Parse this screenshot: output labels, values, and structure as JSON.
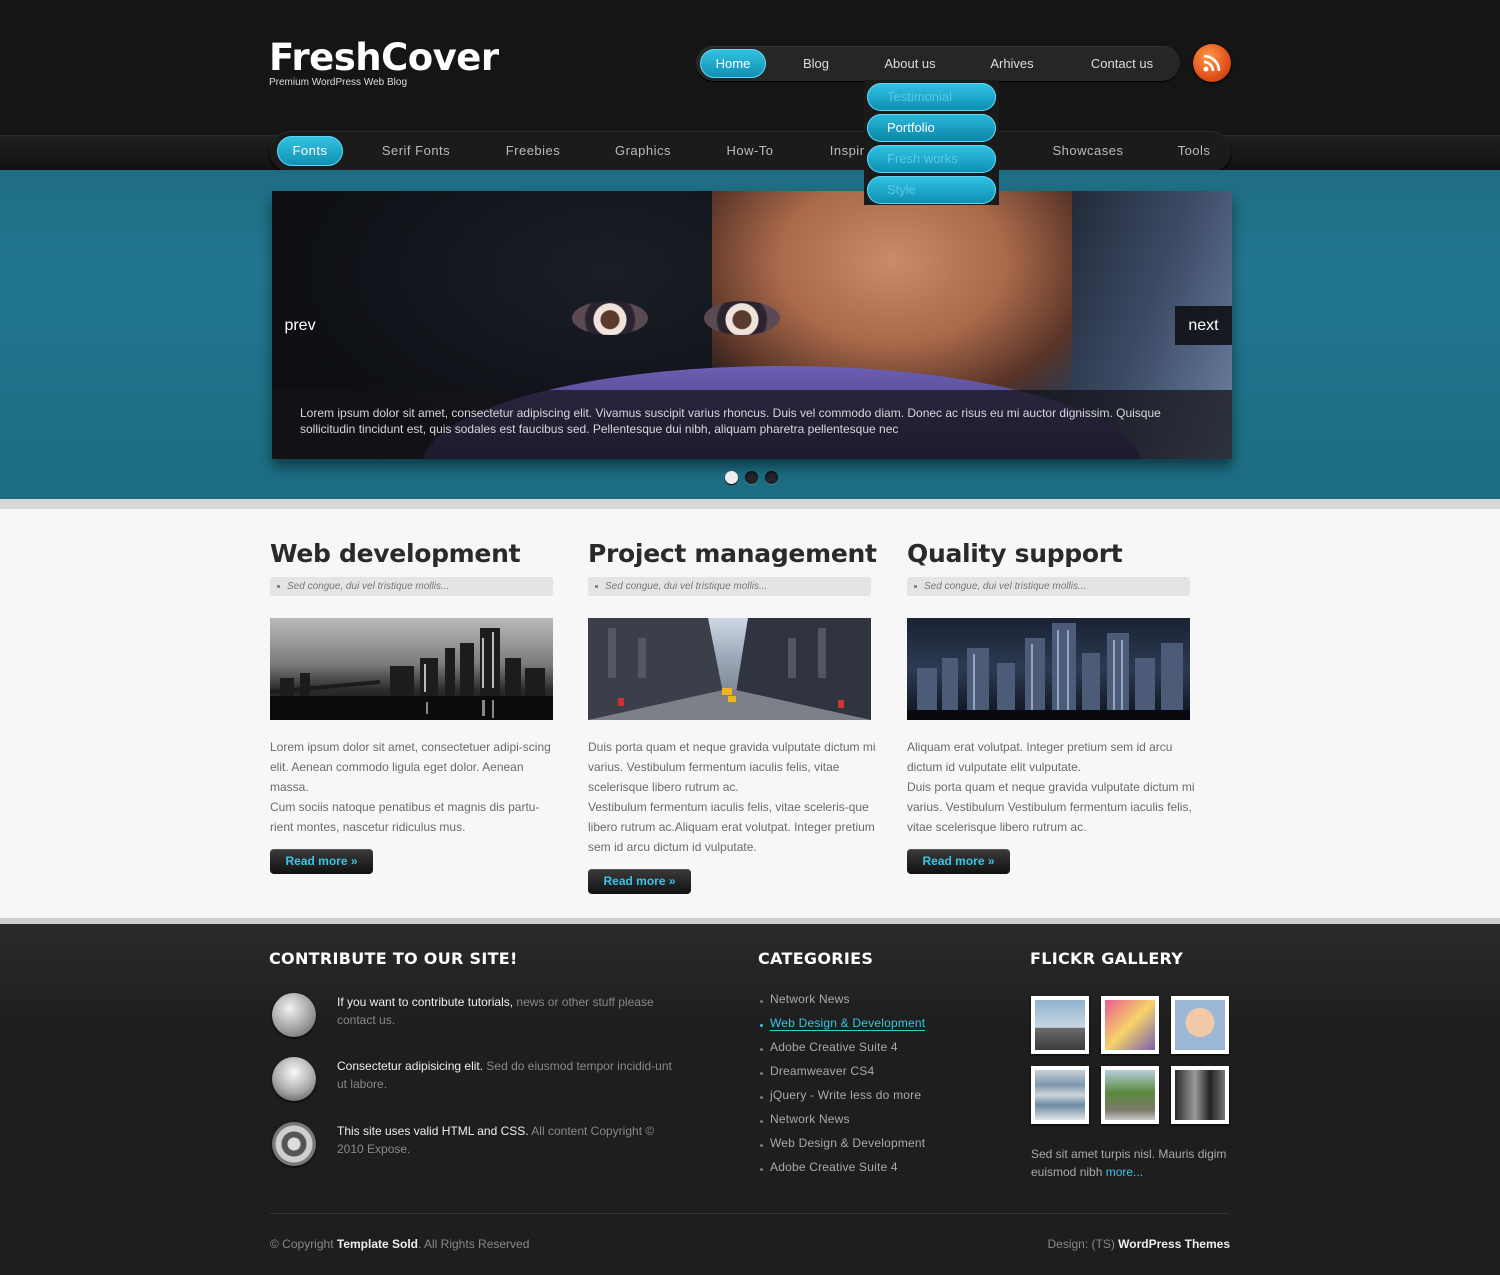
{
  "header": {
    "logo": "FreshCover",
    "tagline": "Premium WordPress Web Blog",
    "nav": [
      "Home",
      "Blog",
      "About us",
      "Arhives",
      "Contact us"
    ],
    "dropdown": [
      "Testimonial",
      "Portfolio",
      "Fresh works",
      "Style"
    ],
    "rss_icon": "rss-icon"
  },
  "subnav": [
    "Fonts",
    "Serif Fonts",
    "Freebies",
    "Graphics",
    "How-To",
    "Inspira",
    "Showcases",
    "Tools"
  ],
  "slider": {
    "prev": "prev",
    "next": "next",
    "caption": "Lorem ipsum dolor sit amet, consectetur adipiscing elit. Vivamus suscipit varius rhoncus. Duis vel commodo diam. Donec ac risus eu mi auctor dignissim. Quisque sollicitudin tincidunt est, quis sodales est faucibus sed. Pellentesque dui nibh, aliquam pharetra pellentesque nec",
    "active_slide": 1,
    "slide_count": 3
  },
  "columns": [
    {
      "title": "Web development",
      "sub": "Sed congue, dui vel tristique mollis...",
      "p1": "Lorem ipsum dolor sit amet, consectetuer adipi-scing elit. Aenean commodo ligula eget dolor. Aenean massa.",
      "p2": "Cum sociis natoque penatibus et magnis dis partu-rient montes, nascetur ridiculus mus.",
      "button": "Read more »"
    },
    {
      "title": "Project management",
      "sub": "Sed congue, dui vel tristique mollis...",
      "p1": "Duis porta quam et neque gravida vulputate dictum mi varius. Vestibulum fermentum iaculis felis, vitae scelerisque libero rutrum ac.",
      "p2": "Vestibulum fermentum iaculis felis, vitae sceleris-que libero rutrum ac.Aliquam erat volutpat. Integer pretium sem id arcu dictum id vulputate.",
      "button": "Read more »"
    },
    {
      "title": "Quality support",
      "sub": "Sed congue, dui vel tristique mollis...",
      "p1": "Aliquam erat volutpat. Integer pretium sem id arcu dictum id vulputate elit vulputate.",
      "p2": "Duis porta quam et neque gravida vulputate dictum mi varius. Vestibulum Vestibulum fermentum iaculis felis, vitae scelerisque libero rutrum ac.",
      "button": "Read more »"
    }
  ],
  "footer": {
    "contribute_title": "CONTRIBUTE TO OUR SITE!",
    "contrib": [
      {
        "bold": "If you want to contribute tutorials,",
        "rest": " news or other stuff please contact us.",
        "icon": "globe-icon"
      },
      {
        "bold": "Consectetur adipisicing elit.",
        "rest": " Sed do eiusmod tempor incidid-unt ut labore.",
        "icon": "users-icon"
      },
      {
        "bold": "This site uses valid HTML and CSS.",
        "rest": " All content Copyright © 2010 Expose.",
        "icon": "film-reel-icon"
      }
    ],
    "categories_title": "CATEGORIES",
    "categories": [
      "Network News",
      "Web Design & Development",
      "Adobe Creative Suite 4",
      "Dreamweaver CS4",
      "jQuery - Write less do more",
      "Network News",
      "Web Design & Development",
      "Adobe Creative Suite 4"
    ],
    "active_category": 1,
    "flickr_title": "FLICKR GALLERY",
    "flickr_text": "Sed sit amet turpis nisl. Mauris digim euismod nibh ",
    "flickr_more": "more...",
    "copyright_pre": "© Copyright ",
    "copyright_bold": "Template Sold",
    "copyright_post": ". All Rights Reserved",
    "design_pre": "Design: (TS) ",
    "design_bold": "WordPress Themes"
  },
  "colors": {
    "accent": "#3cc3e6",
    "band": "#21768e",
    "header_bg": "#151515",
    "content_bg": "#f7f7f7"
  }
}
